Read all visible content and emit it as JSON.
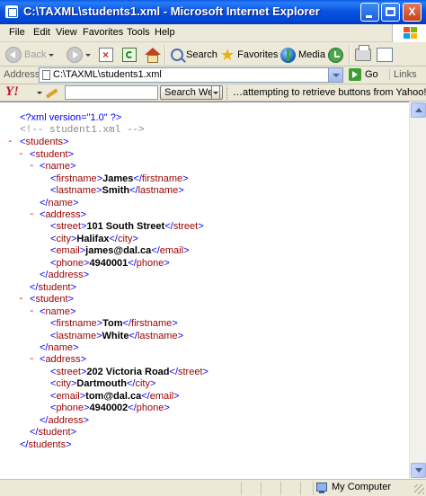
{
  "window": {
    "title": "C:\\TAXML\\students1.xml - Microsoft Internet Explorer",
    "min_glyph": "_",
    "max_glyph": "□",
    "close_glyph": "X"
  },
  "menu": {
    "file": "File",
    "edit": "Edit",
    "view": "View",
    "favorites": "Favorites",
    "tools": "Tools",
    "help": "Help"
  },
  "toolbar": {
    "back": "Back",
    "search": "Search",
    "favorites": "Favorites",
    "media": "Media"
  },
  "address": {
    "label": "Address",
    "value": "C:\\TAXML\\students1.xml",
    "go": "Go",
    "links": "Links"
  },
  "yahoo": {
    "logo": "Y!",
    "search_button": "Search Web",
    "status": "…attempting to retrieve buttons from Yahoo!..."
  },
  "xml": {
    "decl": "<?xml version=\"1.0\" ?>",
    "comment": "<!-- student1.xml -->",
    "tags": {
      "students": "students",
      "student": "student",
      "name": "name",
      "firstname": "firstname",
      "lastname": "lastname",
      "address": "address",
      "street": "street",
      "city": "city",
      "email": "email",
      "phone": "phone"
    },
    "students": [
      {
        "firstname": "James",
        "lastname": "Smith",
        "street": "101 South Street",
        "city": "Halifax",
        "email": "james@dal.ca",
        "phone": "4940001"
      },
      {
        "firstname": "Tom",
        "lastname": "White",
        "street": "202 Victoria Road",
        "city": "Dartmouth",
        "email": "tom@dal.ca",
        "phone": "4940002"
      }
    ]
  },
  "status": {
    "zone": "My Computer"
  },
  "colors": {
    "titlebar": "#0a54e0",
    "xml_bracket": "#0000ff",
    "xml_tag": "#990000",
    "xml_minus": "#ff0000",
    "xml_comment": "#888888"
  }
}
